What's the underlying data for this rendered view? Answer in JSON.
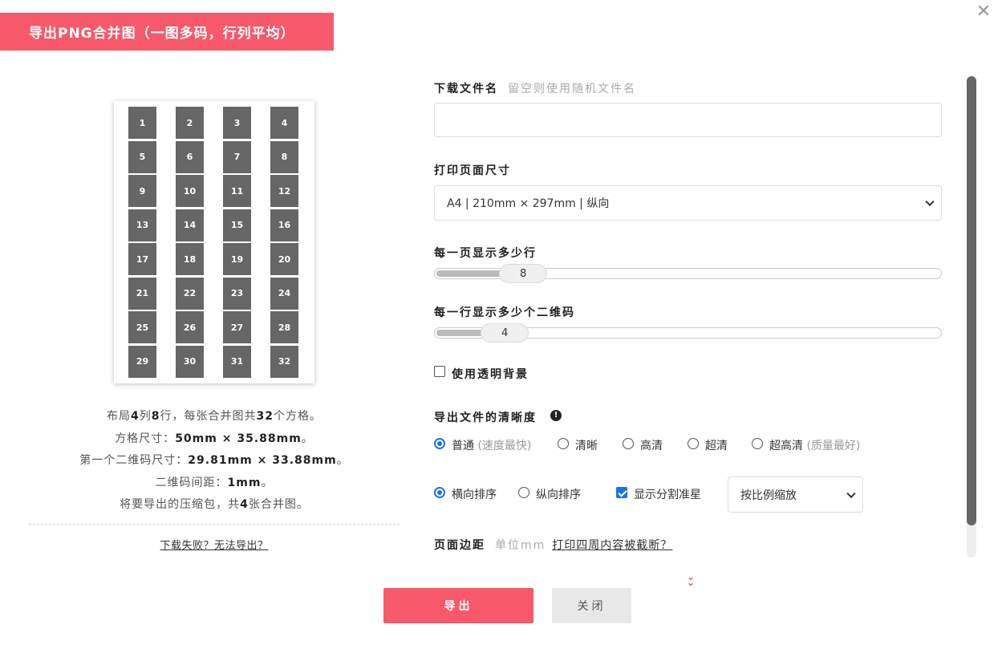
{
  "dialog": {
    "title": "导出PNG合并图（一图多码，行列平均）",
    "close_icon": "close-icon"
  },
  "preview": {
    "cells": [
      "1",
      "2",
      "3",
      "4",
      "5",
      "6",
      "7",
      "8",
      "9",
      "10",
      "11",
      "12",
      "13",
      "14",
      "15",
      "16",
      "17",
      "18",
      "19",
      "20",
      "21",
      "22",
      "23",
      "24",
      "25",
      "26",
      "27",
      "28",
      "29",
      "30",
      "31",
      "32"
    ]
  },
  "info": {
    "line1_a": "布局",
    "cols": "4",
    "line1_b": "列",
    "rows": "8",
    "line1_c": "行，每张合并图共",
    "total": "32",
    "line1_d": "个方格。",
    "line2_a": "方格尺寸：",
    "cell_size": "50mm × 35.88mm",
    "line2_b": "。",
    "line3_a": "第一个二维码尺寸：",
    "qr_size": "29.81mm × 33.88mm",
    "line3_b": "。",
    "line4_a": "二维码间距：",
    "gap": "1mm",
    "line4_b": "。",
    "line5_a": "将要导出的压缩包，共",
    "sheets": "4",
    "line5_b": "张合并图。",
    "fail_link": "下载失败？无法导出？"
  },
  "form": {
    "filename_label": "下载文件名",
    "filename_hint": "留空则使用随机文件名",
    "filename_value": "",
    "page_size_label": "打印页面尺寸",
    "page_size_value": "A4 | 210mm × 297mm | 纵向",
    "rows_label": "每一页显示多少行",
    "rows_value": "8",
    "rows_fraction": 0.07,
    "cols_label": "每一行显示多少个二维码",
    "cols_value": "4",
    "cols_fraction": 0.03,
    "transparent_label": "使用透明背景",
    "transparent_checked": false,
    "clarity_label": "导出文件的清晰度",
    "clarity_options": [
      {
        "label": "普通",
        "sub": "(速度最快)",
        "checked": true
      },
      {
        "label": "清晰",
        "sub": "",
        "checked": false
      },
      {
        "label": "高清",
        "sub": "",
        "checked": false
      },
      {
        "label": "超清",
        "sub": "",
        "checked": false
      },
      {
        "label": "超高清",
        "sub": "(质量最好)",
        "checked": false
      }
    ],
    "order_horizontal": "横向排序",
    "order_vertical": "纵向排序",
    "show_marks": "显示分割准星",
    "show_marks_checked": true,
    "scale_value": "按比例缩放",
    "margin_label": "页面边距",
    "margin_unit": "单位mm",
    "margin_link": "打印四周内容被截断？"
  },
  "buttons": {
    "export": "导出",
    "close": "关闭"
  },
  "colors": {
    "accent": "#f7586a",
    "radio_blue": "#1a73e8",
    "cell_gray": "#666666"
  }
}
